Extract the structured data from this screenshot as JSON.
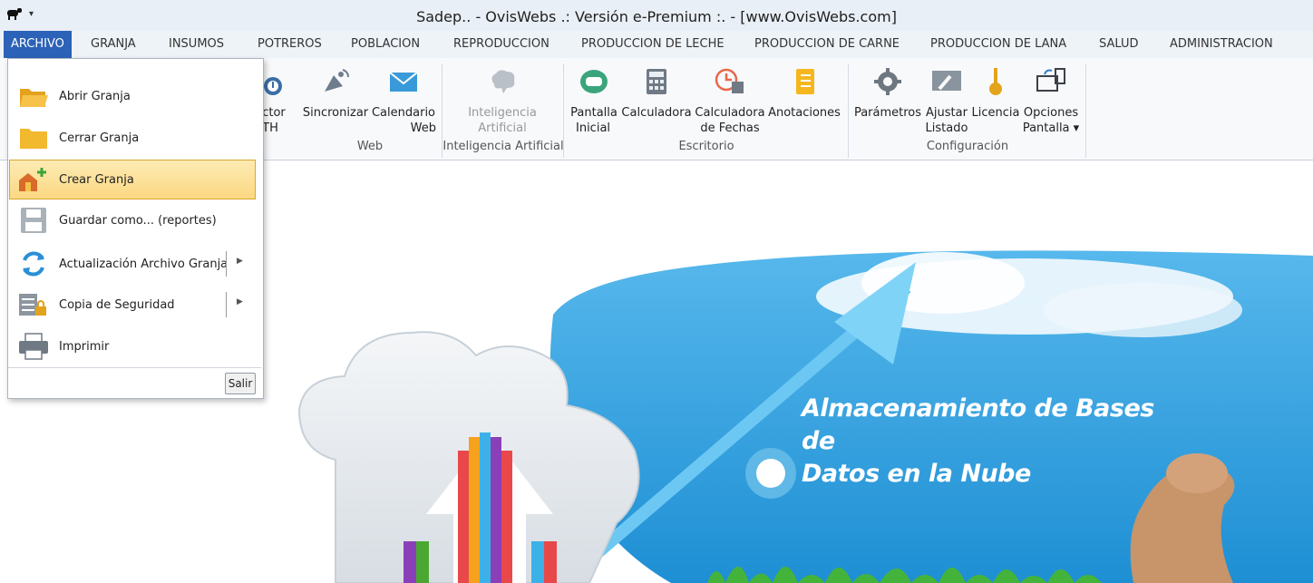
{
  "window": {
    "title": "Sadep.. - OvisWebs  .: Versión e-Premium :. - [www.OvisWebs.com]"
  },
  "tabs": [
    "ARCHIVO",
    "GRANJA",
    "INSUMOS",
    "POTREROS",
    "POBLACION",
    "REPRODUCCION",
    "PRODUCCION DE LECHE",
    "PRODUCCION DE CARNE",
    "PRODUCCION DE LANA",
    "SALUD",
    "ADMINISTRACION"
  ],
  "ribbon": {
    "partial_button": {
      "line1": "ector",
      "line2": "TH"
    },
    "buttons": [
      {
        "line1": "Sincronizar",
        "line2": ""
      },
      {
        "line1": "Calendario",
        "line2": "Web"
      },
      {
        "line1": "Inteligencia",
        "line2": "Artificial"
      },
      {
        "line1": "Pantalla",
        "line2": "Inicial"
      },
      {
        "line1": "Calculadora",
        "line2": ""
      },
      {
        "line1": "Calculadora",
        "line2": "de Fechas"
      },
      {
        "line1": "Anotaciones",
        "line2": ""
      },
      {
        "line1": "Parámetros",
        "line2": ""
      },
      {
        "line1": "Ajustar",
        "line2": "Listado"
      },
      {
        "line1": "Licencia",
        "line2": ""
      },
      {
        "line1": "Opciones",
        "line2": "Pantalla ▾"
      }
    ],
    "groups": [
      "Web",
      "Inteligencia Artificial",
      "Escritorio",
      "Configuración"
    ]
  },
  "menu": {
    "items": [
      {
        "label": "Abrir Granja"
      },
      {
        "label": "Cerrar Granja"
      },
      {
        "label": "Crear Granja"
      },
      {
        "label": "Guardar como... (reportes)"
      },
      {
        "label": "Actualización Archivo Granja"
      },
      {
        "label": "Copia de Seguridad"
      },
      {
        "label": "Imprimir"
      }
    ],
    "exit_label": "Salir"
  },
  "banner": {
    "line1": "Almacenamiento de Bases de",
    "line2": "Datos en la Nube"
  },
  "colors": {
    "active_tab": "#2c62b7",
    "highlight": "#fbd882",
    "sky": "#2e9fe0"
  }
}
